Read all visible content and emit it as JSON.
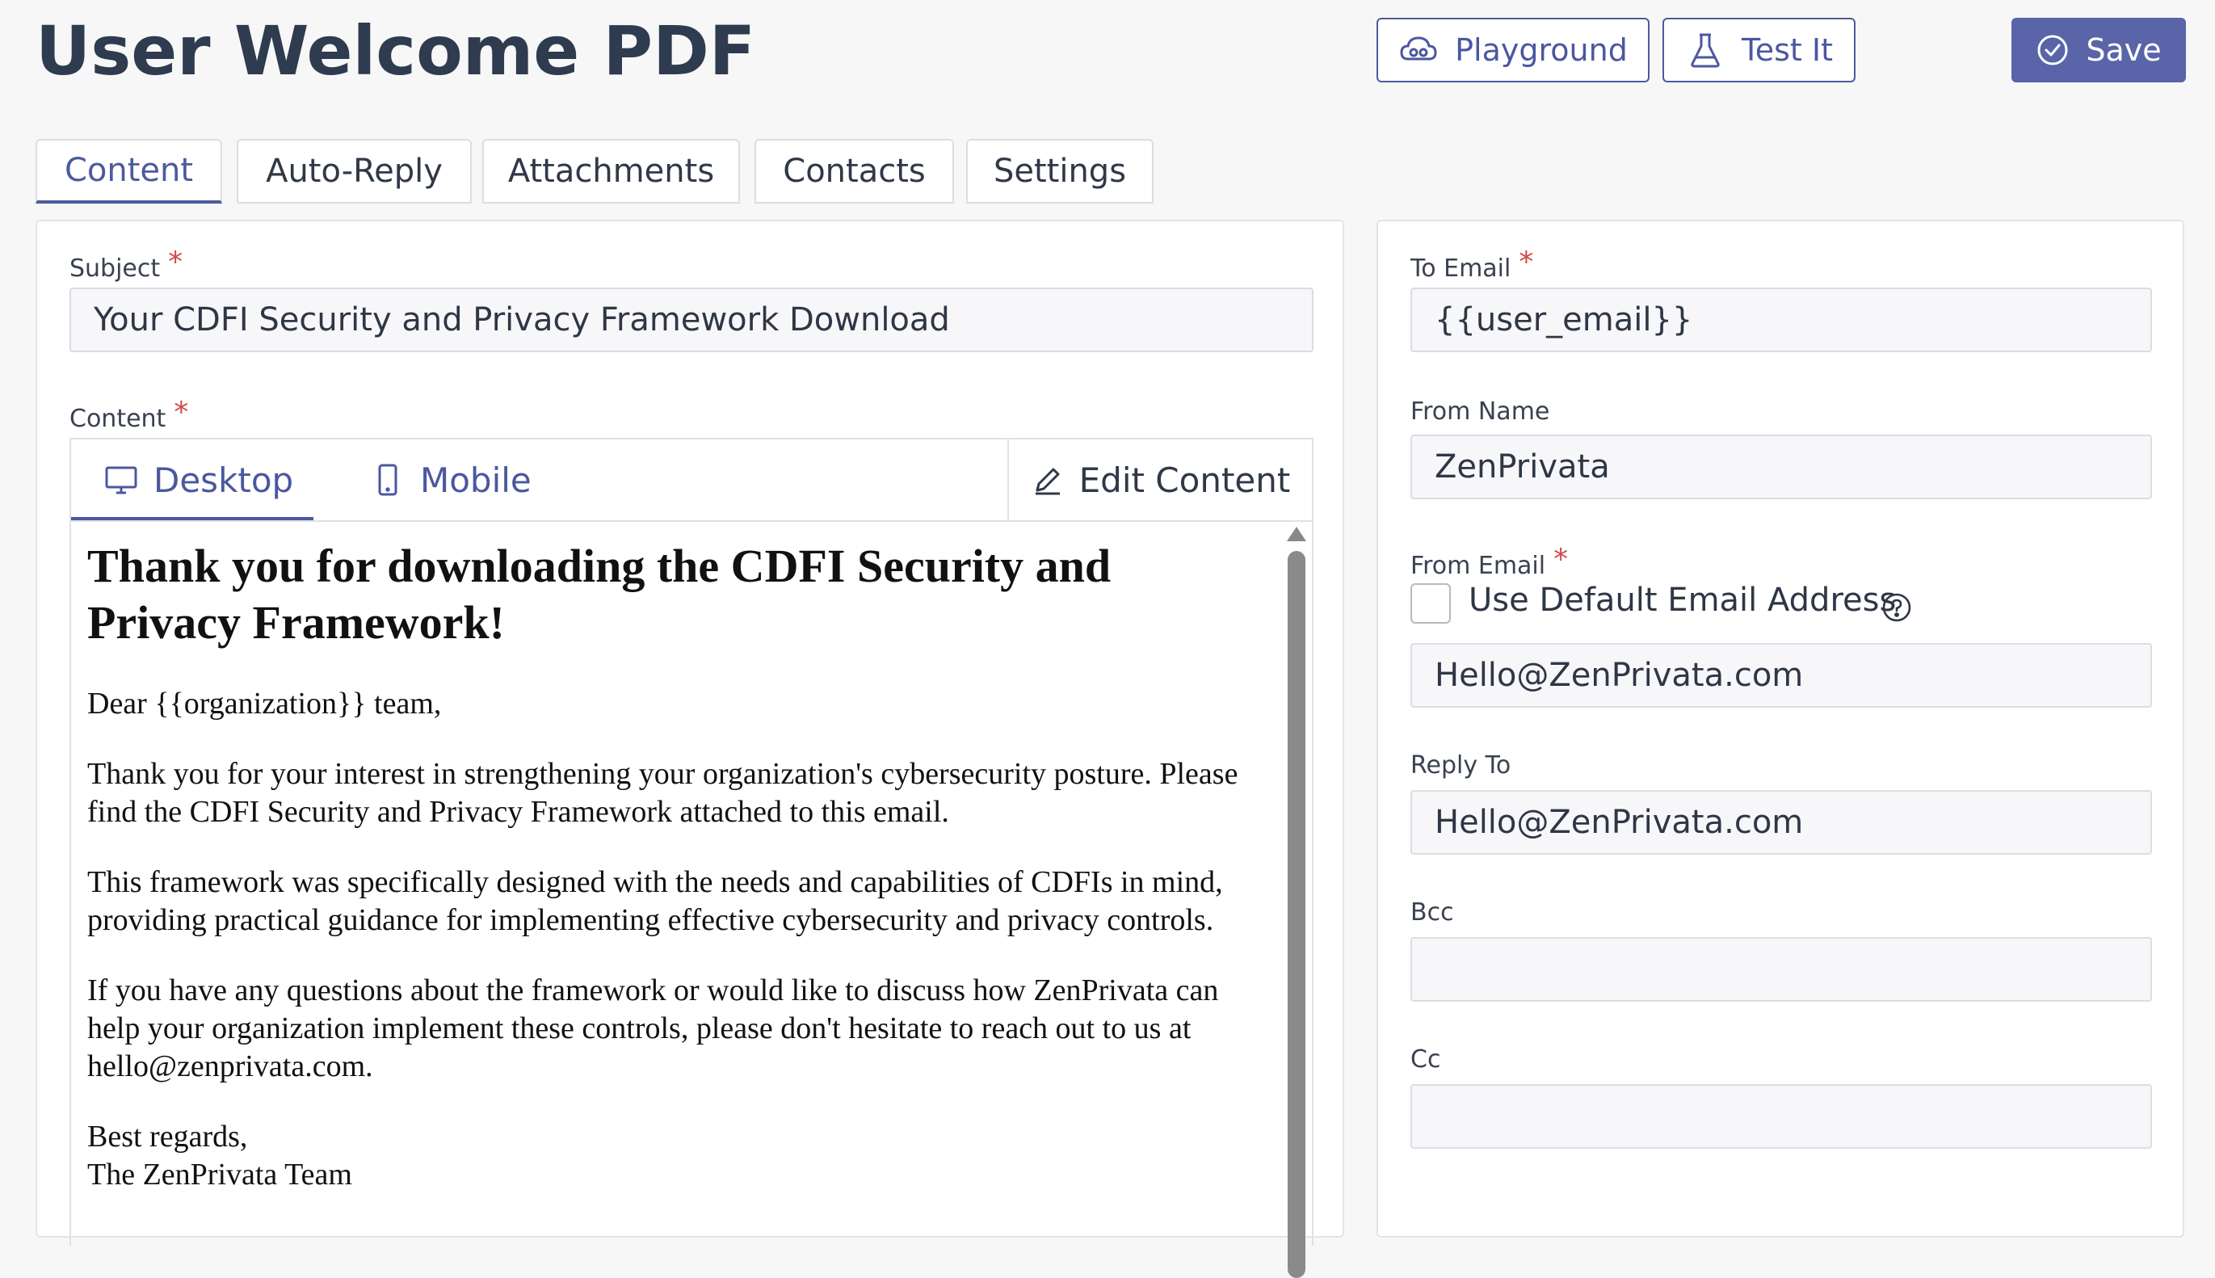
{
  "page": {
    "title": "User Welcome PDF"
  },
  "header": {
    "playground_label": "Playground",
    "test_label": "Test It",
    "save_label": "Save",
    "icons": [
      "cloud-gamepad-icon",
      "flask-icon",
      "check-circle-icon"
    ],
    "accent_color": "#5a64a8"
  },
  "tabs": [
    {
      "label": "Content",
      "active": true
    },
    {
      "label": "Auto-Reply",
      "active": false
    },
    {
      "label": "Attachments",
      "active": false
    },
    {
      "label": "Contacts",
      "active": false
    },
    {
      "label": "Settings",
      "active": false
    }
  ],
  "content_panel": {
    "subject_label": "Subject",
    "subject_value": "Your CDFI Security and Privacy Framework Download",
    "content_label": "Content",
    "required_marker": "*",
    "editor": {
      "desktop_label": "Desktop",
      "mobile_label": "Mobile",
      "edit_label": "Edit Content",
      "active_view": "Desktop"
    },
    "preview": {
      "heading": "Thank you for downloading the CDFI Security and Privacy Framework!",
      "paragraphs": [
        "Dear {{organization}} team,",
        "Thank you for your interest in strengthening your organization's cybersecurity posture. Please find the CDFI Security and Privacy Framework attached to this email.",
        "This framework was specifically designed with the needs and capabilities of CDFIs in mind, providing practical guidance for implementing effective cybersecurity and privacy controls.",
        "If you have any questions about the framework or would like to discuss how ZenPrivata can help your organization implement these controls, please don't hesitate to reach out to us at hello@zenprivata.com.",
        "Best regards,",
        "The ZenPrivata Team"
      ]
    }
  },
  "email_panel": {
    "to_email_label": "To Email",
    "to_email_value": "{{user_email}}",
    "from_name_label": "From Name",
    "from_name_value": "ZenPrivata",
    "from_email_label": "From Email",
    "use_default_label": "Use Default Email Address",
    "use_default_checked": false,
    "from_email_value": "Hello@ZenPrivata.com",
    "reply_to_label": "Reply To",
    "reply_to_value": "Hello@ZenPrivata.com",
    "bcc_label": "Bcc",
    "bcc_value": "",
    "cc_label": "Cc",
    "cc_value": ""
  }
}
